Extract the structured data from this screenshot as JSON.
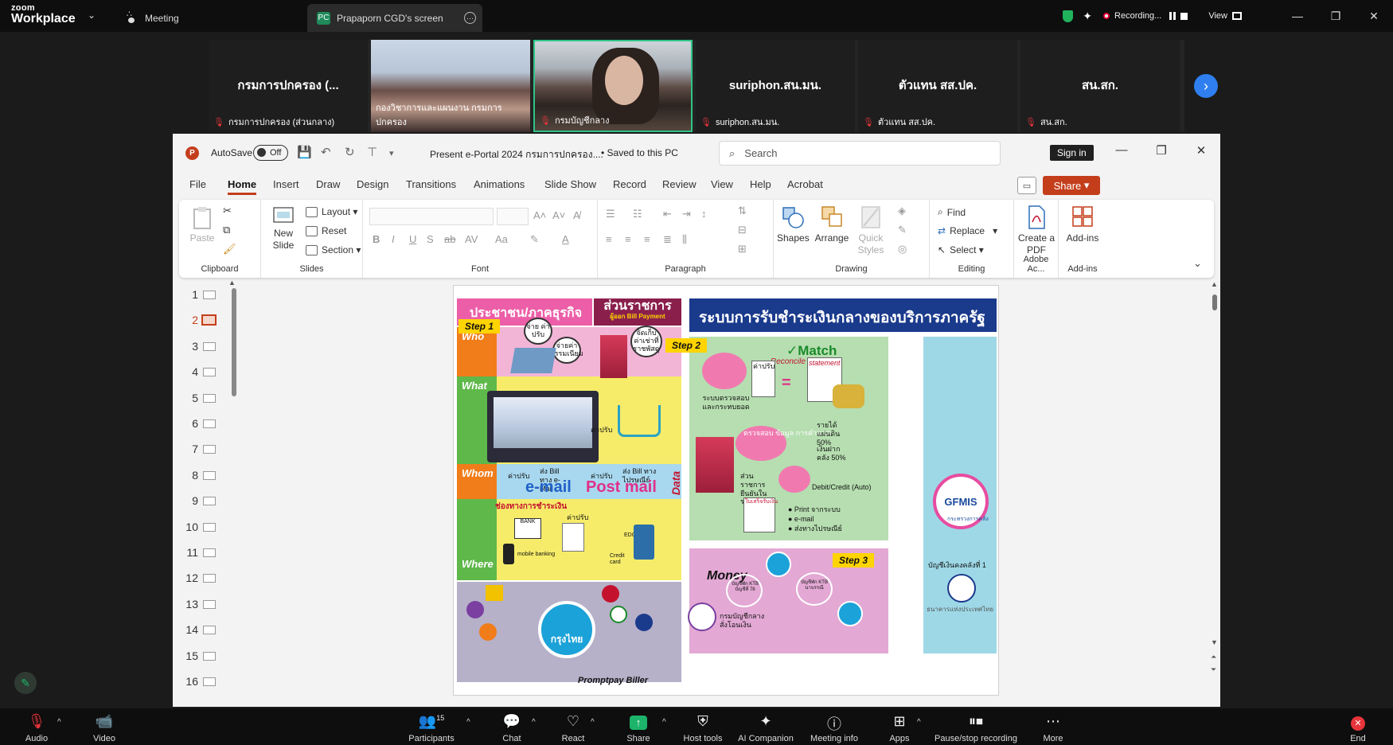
{
  "zoom": {
    "logo_top": "zoom",
    "logo_bottom": "Workplace",
    "tab_meeting": "Meeting",
    "tab_screen": "Prapaporn CGD's screen",
    "tab_screen_badge": "PC",
    "recording_label": "Recording...",
    "view_label": "View",
    "participants_count": "15",
    "toolbar": {
      "audio": "Audio",
      "video": "Video",
      "participants": "Participants",
      "chat": "Chat",
      "react": "React",
      "share": "Share",
      "host_tools": "Host tools",
      "ai_companion": "AI Companion",
      "meeting_info": "Meeting info",
      "apps": "Apps",
      "pause_stop": "Pause/stop recording",
      "more": "More",
      "end": "End"
    }
  },
  "participants": [
    {
      "big": "กรมการปกครอง (...",
      "name": "กรมการปกครอง (ส่วนกลาง)"
    },
    {
      "big": "",
      "name": "กองวิชาการและแผนงาน กรมการปกครอง"
    },
    {
      "big": "",
      "name": "กรมบัญชีกลาง"
    },
    {
      "big": "suriphon.สน.มน.",
      "name": "suriphon.สน.มน."
    },
    {
      "big": "ตัวแทน สส.ปค.",
      "name": "ตัวแทน สส.ปค."
    },
    {
      "big": "สน.สก.",
      "name": "สน.สก."
    }
  ],
  "ppt": {
    "autosave": "AutoSave",
    "autosave_state": "Off",
    "doc_title": "Present e-Portal 2024 กรมการปกครอง....",
    "saved": "• Saved to this PC",
    "search_placeholder": "Search",
    "sign_in": "Sign in",
    "share": "Share",
    "menu": [
      "File",
      "Home",
      "Insert",
      "Draw",
      "Design",
      "Transitions",
      "Animations",
      "Slide Show",
      "Record",
      "Review",
      "View",
      "Help",
      "Acrobat"
    ],
    "active_menu": "Home",
    "ribbon": {
      "paste": "Paste",
      "clipboard": "Clipboard",
      "new_slide": "New Slide",
      "layout": "Layout",
      "reset": "Reset",
      "section": "Section",
      "slides": "Slides",
      "font": "Font",
      "paragraph": "Paragraph",
      "shapes": "Shapes",
      "arrange": "Arrange",
      "quick_styles": "Quick Styles",
      "drawing": "Drawing",
      "find": "Find",
      "replace": "Replace",
      "select": "Select",
      "editing": "Editing",
      "create_pdf": "Create a PDF",
      "adobe": "Adobe Ac...",
      "addins_btn": "Add-ins",
      "addins": "Add-ins"
    },
    "slide_numbers": [
      "1",
      "2",
      "3",
      "4",
      "5",
      "6",
      "7",
      "8",
      "9",
      "10",
      "11",
      "12",
      "13",
      "14",
      "15",
      "16"
    ],
    "selected_slide": "2"
  },
  "slide": {
    "header_left": "ประชาชน/ภาคธุรกิจ",
    "header_mid": "ส่วนราชการ",
    "header_mid_sub": "ผู้ออก Bill Payment",
    "header_right": "ระบบการรับชำระเงินกลางของบริการภาครัฐ",
    "step1": "Step 1",
    "step2": "Step 2",
    "step3": "Step 3",
    "who": "Who",
    "what": "What",
    "whom": "Whom",
    "where": "Where",
    "bubble1": "จ่าย ค่าปรับ",
    "bubble2": "จ่ายค่า ธรรมเนียม",
    "bubble3": "จัดเก็บ ค่าเช่าที่ ราชพัสดุ",
    "send_email": "ส่ง Bill ทาง e-Mail",
    "send_post": "ส่ง Bill ทางไปรษณีย์",
    "fine": "ค่าปรับ",
    "email": "e-mail",
    "postmail": "Post mail",
    "channels": "ช่องทางการชำระเงิน",
    "bank": "BANK",
    "mobile_banking": "mobile banking",
    "edc": "EDC",
    "credit_card": "Credit card",
    "ktb": "กรุงไทย",
    "promptpay": "Promptpay Biller",
    "match": "Match",
    "reconcile": "Reconcile system",
    "statement": "statement",
    "check_system": "ระบบตรวจสอบ และกระทบยอด",
    "data": "Data",
    "verify": "ตรวจสอบ ข้อมูล การคำนวณ",
    "revenue": "รายได้ แผ่นดิน 50%",
    "deposit": "เงินฝากคลัง 50%",
    "gov_confirm": "ส่วนราชการ ยืนยันในระบบ",
    "debit_credit": "Debit/Credit (Auto)",
    "print": "● Print จากระบบ",
    "email_dot": "● e-mail",
    "post_dot": "● ส่งทางไปรษณีย์",
    "receipt": "ใบเสร็จรับเงิน",
    "money": "Money",
    "acct1": "บัญชีพัก KTB บัญชีที่ 78",
    "acct2": "บัญชีพัก KTB นาบรรณี",
    "cgd": "กรมบัญชีกลาง สั่งโอนเงิน",
    "treasury": "บัญชีเงินคงคลังที่ 1",
    "bot": "ธนาคารแห่งประเทศไทย",
    "gfmis": "GFMIS",
    "gfmis_sub": "กระทรวงการคลัง"
  }
}
